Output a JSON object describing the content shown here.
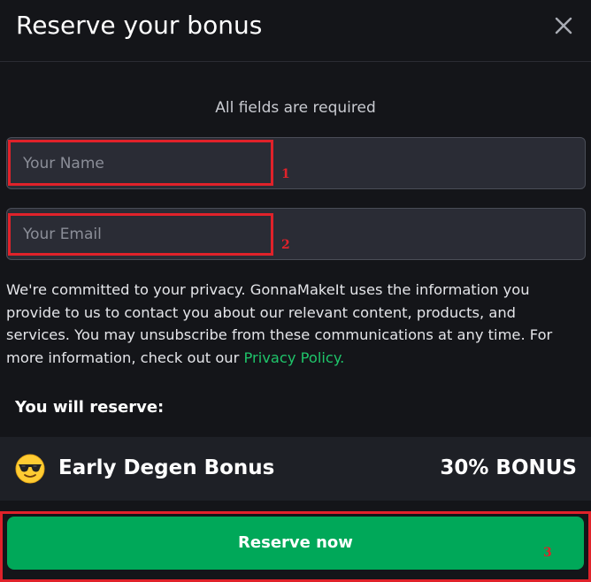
{
  "header": {
    "title": "Reserve your bonus",
    "close_icon": "close-icon"
  },
  "form": {
    "required_note": "All fields are required",
    "name_placeholder": "Your Name",
    "name_value": "",
    "email_placeholder": "Your Email",
    "email_value": ""
  },
  "privacy": {
    "text": "We're committed to your privacy. GonnaMakeIt uses the information you provide to us to contact you about our relevant content, products, and services. You may unsubscribe from these communications at any time. For more information, check out our ",
    "link_label": "Privacy Policy."
  },
  "reserve": {
    "label": "You will reserve:",
    "bonus_icon": "sunglasses-emoji-icon",
    "bonus_name": "Early Degen Bonus",
    "bonus_amount": "30% BONUS",
    "button_label": "Reserve now"
  },
  "annotations": {
    "name_marker": "1",
    "email_marker": "2",
    "button_marker": "3",
    "color": "#e0222a"
  },
  "colors": {
    "background": "#141519",
    "input_background": "#2a2c35",
    "accent_green": "#00a859",
    "link_green": "#1fc46a"
  }
}
